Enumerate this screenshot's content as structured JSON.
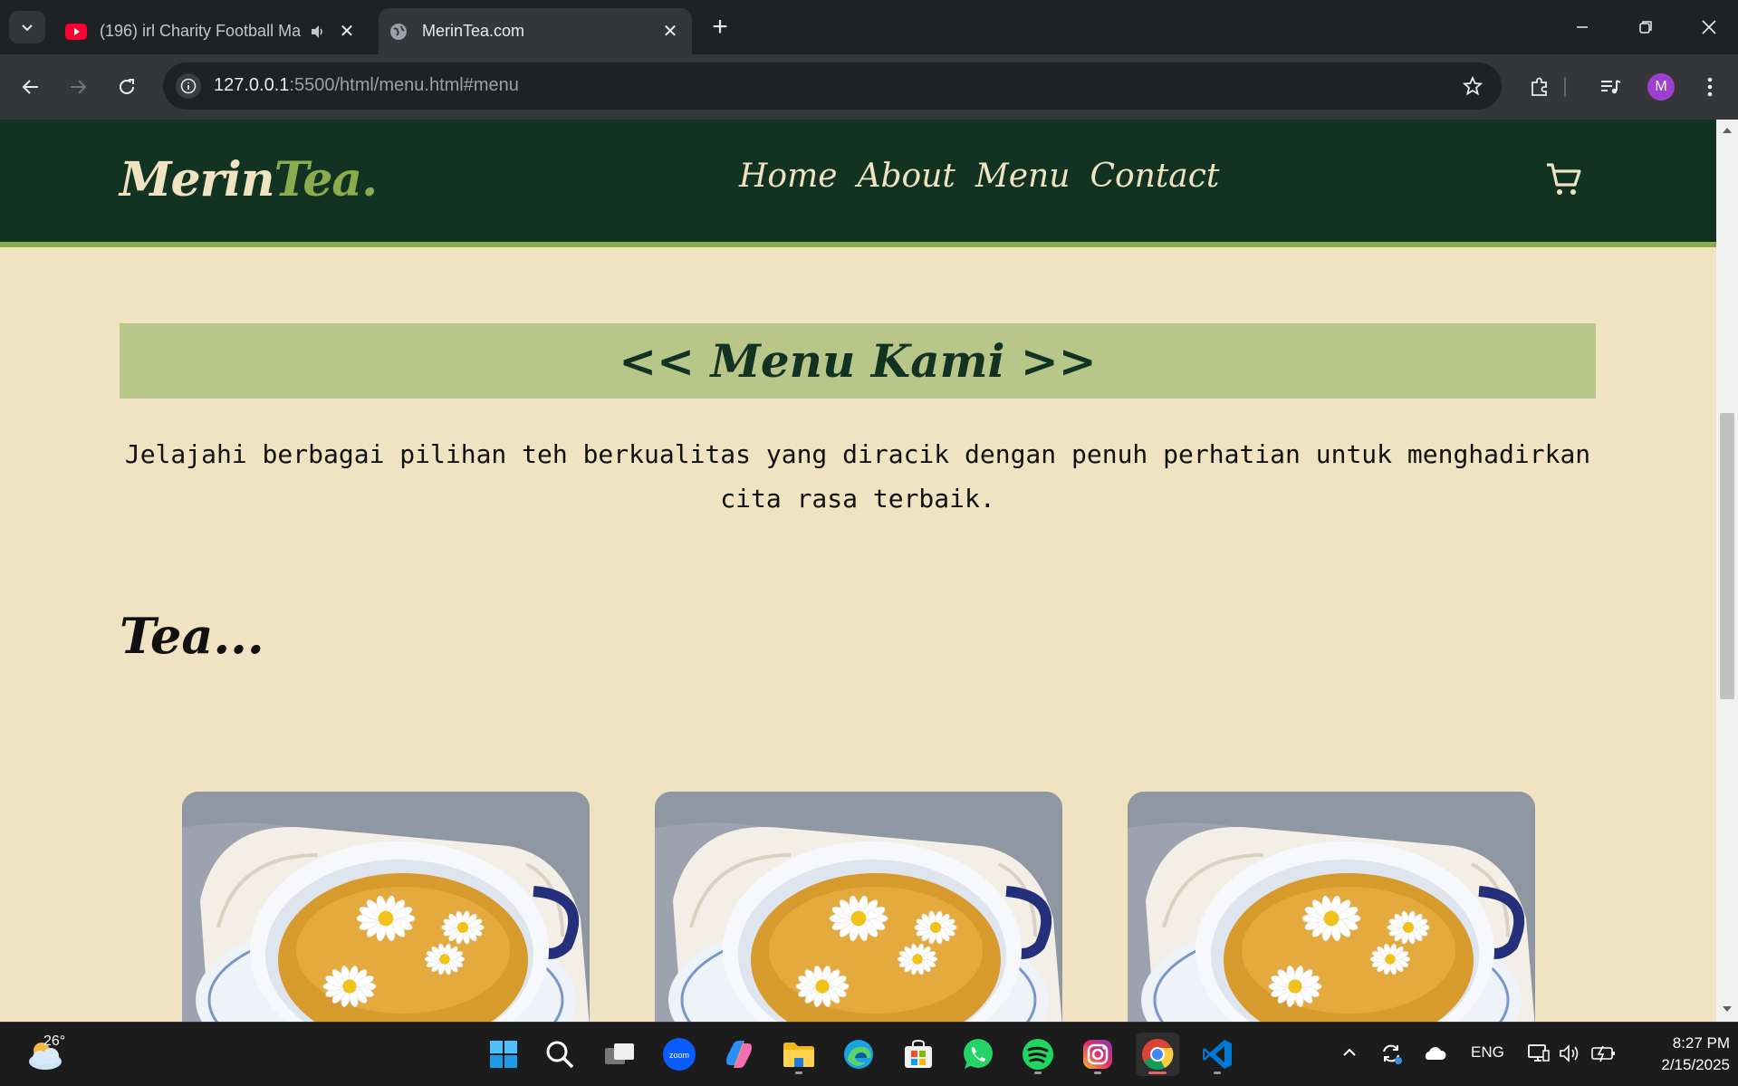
{
  "browser": {
    "tabs": [
      {
        "title": "(196) irl Charity Football Ma",
        "favicon": "youtube-icon",
        "audio": true,
        "active": false
      },
      {
        "title": "MerinTea.com",
        "favicon": "globe-icon",
        "active": true
      }
    ],
    "address": {
      "host": "127.0.0.1",
      "rest": ":5500/html/menu.html#menu"
    },
    "profile_initial": "M"
  },
  "site": {
    "logo_main": "Merin",
    "logo_accent": "Tea.",
    "nav": [
      "Home",
      "About",
      "Menu",
      "Contact"
    ],
    "colors": {
      "header": "#133322",
      "accent": "#8aab4e",
      "background": "#f0e3c1",
      "banner": "#b8c689"
    }
  },
  "menu": {
    "heading": "<< Menu Kami >>",
    "intro_line1": "Jelajahi berbagai pilihan teh berkualitas yang diracik dengan penuh perhatian untuk menghadirkan",
    "intro_line2": "cita rasa terbaik.",
    "section": "Tea..."
  },
  "taskbar": {
    "temperature": "26°",
    "language": "ENG",
    "time": "8:27 PM",
    "date": "2/15/2025",
    "apps": [
      "start-icon",
      "search-icon",
      "task-view-icon",
      "zoom-icon",
      "copilot-icon",
      "file-explorer-icon",
      "edge-icon",
      "store-icon",
      "whatsapp-icon",
      "spotify-icon",
      "instagram-icon",
      "chrome-icon",
      "vscode-icon"
    ]
  }
}
